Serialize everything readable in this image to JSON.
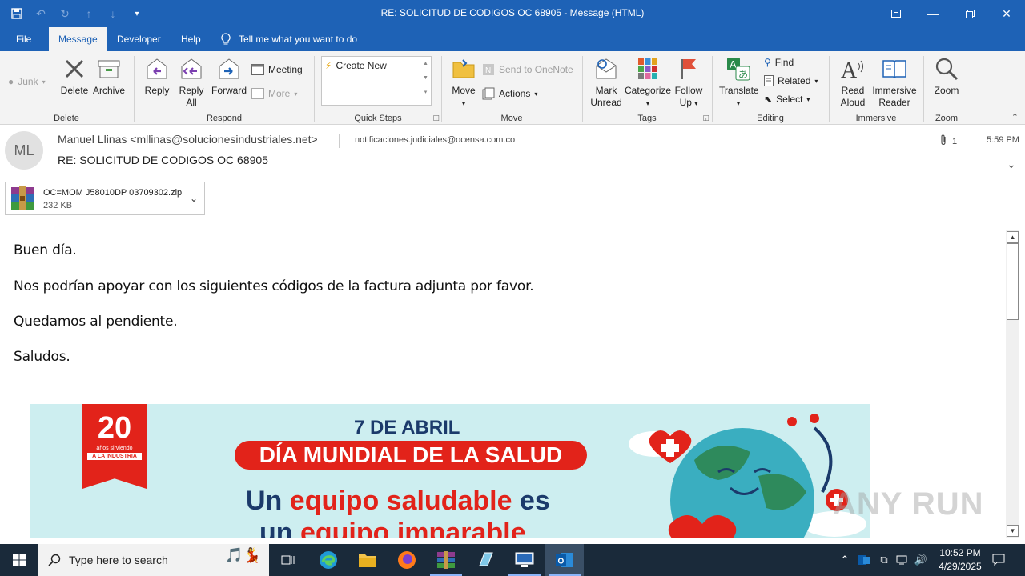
{
  "window": {
    "title": "RE: SOLICITUD DE CODIGOS OC 68905  -  Message (HTML)"
  },
  "tabs": [
    {
      "label": "File"
    },
    {
      "label": "Message"
    },
    {
      "label": "Developer"
    },
    {
      "label": "Help"
    }
  ],
  "tell_me": "Tell me what you want to do",
  "ribbon": {
    "delete_group": {
      "label": "Delete",
      "junk": "Junk",
      "delete": "Delete",
      "archive": "Archive"
    },
    "respond_group": {
      "label": "Respond",
      "reply": "Reply",
      "reply_all_1": "Reply",
      "reply_all_2": "All",
      "forward": "Forward",
      "meeting": "Meeting",
      "more": "More"
    },
    "quicksteps_group": {
      "label": "Quick Steps",
      "create_new": "Create New"
    },
    "move_group": {
      "label": "Move",
      "move": "Move",
      "send_onenote": "Send to OneNote",
      "actions": "Actions"
    },
    "tags_group": {
      "label": "Tags",
      "mark_1": "Mark",
      "mark_2": "Unread",
      "categorize": "Categorize",
      "follow_1": "Follow",
      "follow_2": "Up"
    },
    "editing_group": {
      "label": "Editing",
      "translate": "Translate",
      "find": "Find",
      "related": "Related",
      "select": "Select"
    },
    "immersive_group": {
      "label": "Immersive",
      "read_1": "Read",
      "read_2": "Aloud",
      "imm_1": "Immersive",
      "imm_2": "Reader"
    },
    "zoom_group": {
      "label": "Zoom",
      "zoom": "Zoom"
    }
  },
  "message": {
    "avatar_initials": "ML",
    "from": "Manuel Llinas <mllinas@solucionesindustriales.net>",
    "to": "notificaciones.judiciales@ocensa.com.co",
    "subject": "RE: SOLICITUD DE CODIGOS OC 68905",
    "attachment_count": "1",
    "time": "5:59 PM"
  },
  "attachment": {
    "filename": "OC=MOM J58010DP 03709302.zip",
    "size": "232 KB"
  },
  "body": {
    "line1": "Buen día.",
    "line2": "Nos podrían apoyar con los siguientes códigos de la factura adjunta por favor.",
    "line3": "Quedamos al pendiente.",
    "line4": "Saludos."
  },
  "banner": {
    "badge_number": "20",
    "badge_small": "años sirviendo",
    "badge_band": "A LA INDUSTRIA",
    "date": "7 DE ABRIL",
    "headline": "DÍA MUNDIAL DE LA SALUD",
    "l1_a": "Un ",
    "l1_b": "equipo saludable",
    "l1_c": " es",
    "l2_a": "un ",
    "l2_b": "equipo imparable"
  },
  "watermark": "ANY RUN",
  "taskbar": {
    "search_placeholder": "Type here to search",
    "time": "10:52 PM",
    "date": "4/29/2025"
  },
  "colors": {
    "titlebar": "#1e62b6",
    "ribbon": "#f3f3f3",
    "banner_red": "#e2231a",
    "banner_navy": "#1b3a6b",
    "banner_bg": "#cdeef0"
  }
}
